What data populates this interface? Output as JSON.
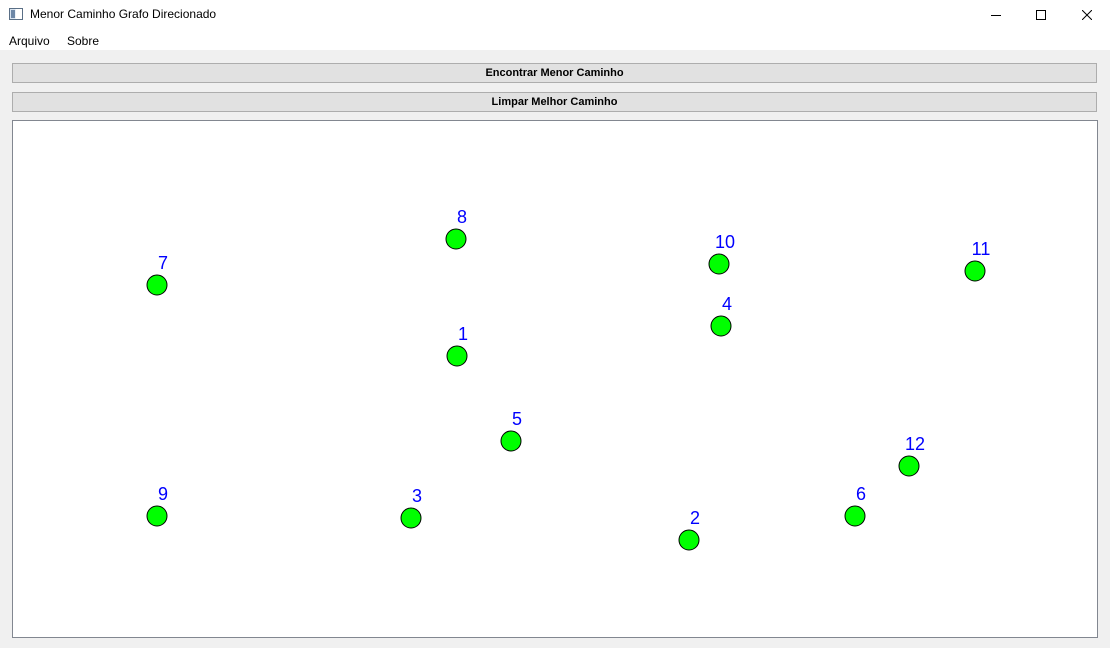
{
  "window": {
    "title": "Menor Caminho Grafo Direcionado"
  },
  "menu": {
    "items": [
      "Arquivo",
      "Sobre"
    ]
  },
  "toolbar": {
    "find_label": "Encontrar Menor Caminho",
    "clear_label": "Limpar Melhor Caminho"
  },
  "colors": {
    "node_fill": "#00ff00",
    "label_color": "#0000ff"
  },
  "graph": {
    "nodes": [
      {
        "label": "1"
      },
      {
        "label": "2"
      },
      {
        "label": "3"
      },
      {
        "label": "4"
      },
      {
        "label": "5"
      },
      {
        "label": "6"
      },
      {
        "label": "7"
      },
      {
        "label": "8"
      },
      {
        "label": "9"
      },
      {
        "label": "10"
      },
      {
        "label": "11"
      },
      {
        "label": "12"
      }
    ]
  }
}
